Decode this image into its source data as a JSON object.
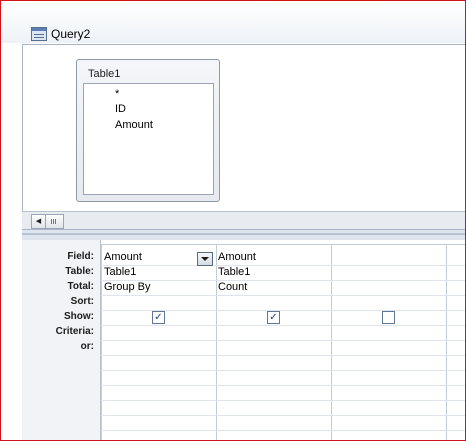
{
  "window": {
    "title": "Query2"
  },
  "table": {
    "name": "Table1",
    "fields": [
      "*",
      "ID",
      "Amount"
    ]
  },
  "scrollbar": {
    "left_arrow": "◀"
  },
  "grid": {
    "row_labels": [
      "Field:",
      "Table:",
      "Total:",
      "Sort:",
      "Show:",
      "Criteria:",
      "or:"
    ],
    "columns": [
      {
        "field": "Amount",
        "table": "Table1",
        "total": "Group By",
        "sort": "",
        "show": true,
        "show_mark": "✓"
      },
      {
        "field": "Amount",
        "table": "Table1",
        "total": "Count",
        "sort": "",
        "show": true,
        "show_mark": "✓"
      },
      {
        "field": "",
        "table": "",
        "total": "",
        "sort": "",
        "show": false,
        "show_mark": ""
      }
    ]
  }
}
